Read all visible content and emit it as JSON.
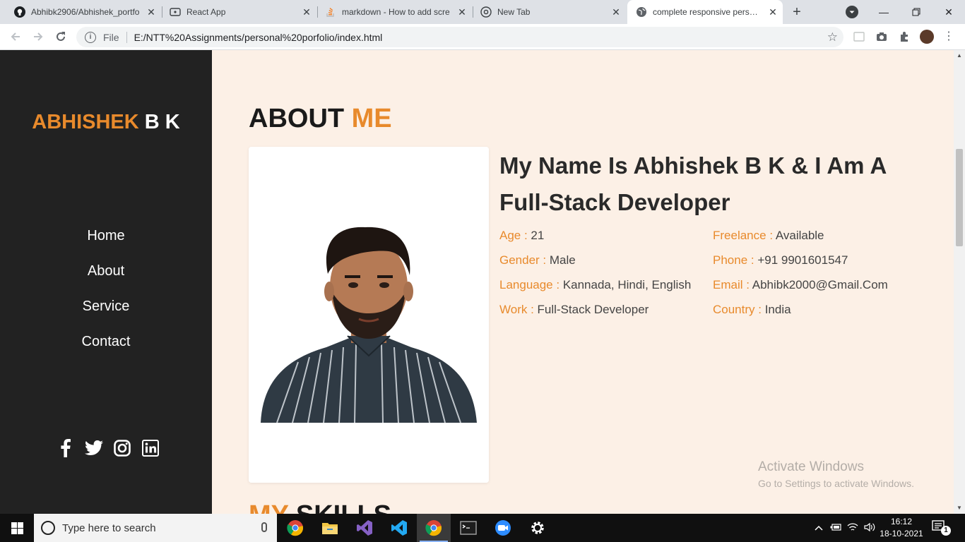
{
  "browser": {
    "tabs": [
      {
        "title": "Abhibk2906/Abhishek_portfo",
        "icon": "github-icon",
        "active": false
      },
      {
        "title": "React App",
        "icon": "react-icon",
        "active": false
      },
      {
        "title": "markdown - How to add scre",
        "icon": "stackoverflow-icon",
        "active": false
      },
      {
        "title": "New Tab",
        "icon": "chrome-icon",
        "active": false
      },
      {
        "title": "complete responsive persona",
        "icon": "globe-icon",
        "active": true
      }
    ],
    "address": {
      "scheme": "File",
      "url": "E:/NTT%20Assignments/personal%20porfolio/index.html"
    }
  },
  "sidebar": {
    "brand_first": "ABHISHEK",
    "brand_rest": " B K",
    "nav": [
      "Home",
      "About",
      "Service",
      "Contact"
    ],
    "social_icons": [
      "facebook-icon",
      "twitter-icon",
      "instagram-icon",
      "linkedin-icon"
    ]
  },
  "about": {
    "heading_main": "ABOUT ",
    "heading_accent": "ME",
    "headline": "My Name Is Abhishek B K & I Am A Full-Stack Developer",
    "left_info": [
      {
        "label": "Age : ",
        "value": "21"
      },
      {
        "label": "Gender : ",
        "value": "Male"
      },
      {
        "label": "Language : ",
        "value": "Kannada, Hindi, English"
      },
      {
        "label": "Work : ",
        "value": "Full-Stack Developer"
      }
    ],
    "right_info": [
      {
        "label": "Freelance : ",
        "value": "Available"
      },
      {
        "label": "Phone : ",
        "value": "+91 9901601547"
      },
      {
        "label": "Email : ",
        "value": "Abhibk2000@Gmail.Com"
      },
      {
        "label": "Country : ",
        "value": "India"
      }
    ]
  },
  "skills": {
    "heading_accent": "MY",
    "heading_main": " SKILLS"
  },
  "watermark": {
    "line1": "Activate Windows",
    "line2": "Go to Settings to activate Windows."
  },
  "taskbar": {
    "search_placeholder": "Type here to search",
    "time": "16:12",
    "date": "18-10-2021",
    "notification_count": "1"
  },
  "colors": {
    "accent": "#e88a2c",
    "sidebar_bg": "#222222",
    "page_bg": "#fcf0e6"
  }
}
